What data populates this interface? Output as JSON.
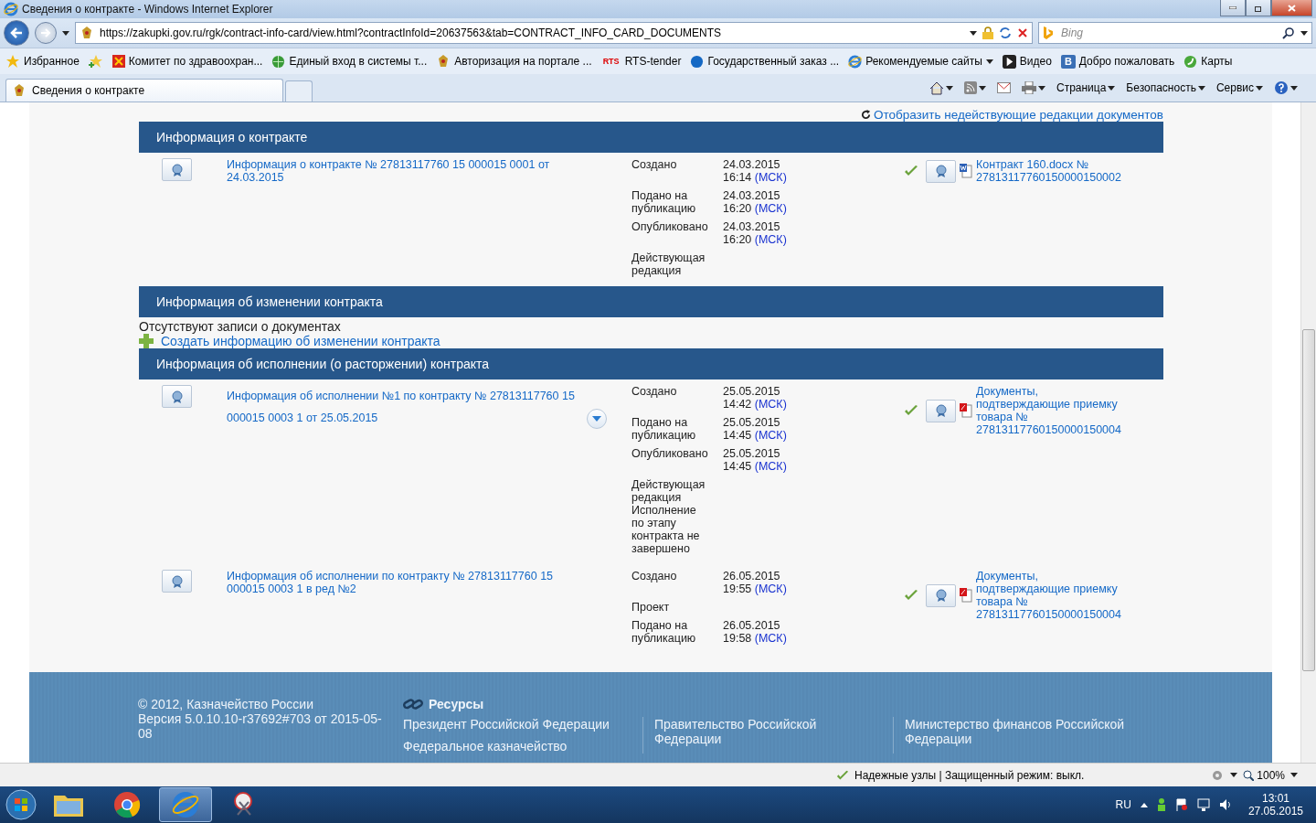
{
  "window": {
    "title": "Сведения о контракте - Windows Internet Explorer"
  },
  "address_bar": {
    "url": "https://zakupki.gov.ru/rgk/contract-info-card/view.html?contractInfoId=20637563&tab=CONTRACT_INFO_CARD_DOCUMENTS",
    "search_placeholder": "Bing"
  },
  "favorites_bar": {
    "title": "Избранное",
    "items": [
      {
        "label": "Комитет по здравоохран...",
        "kind": "red"
      },
      {
        "label": "Единый вход в системы т...",
        "kind": "green"
      },
      {
        "label": "Авторизация на портале ...",
        "kind": "emblem"
      },
      {
        "label": "RTS-tender",
        "kind": "logo",
        "badge": "RTS"
      },
      {
        "label": "Государственный заказ ...",
        "kind": "blue"
      },
      {
        "label": "Рекомендуемые сайты",
        "kind": "page",
        "dropdown": true
      },
      {
        "label": "Видео",
        "kind": "video"
      },
      {
        "label": "Добро пожаловать",
        "kind": "letter",
        "badge": "B"
      },
      {
        "label": "Карты",
        "kind": "maps"
      }
    ]
  },
  "tabs": [
    {
      "label": "Сведения о контракте",
      "selected": true
    }
  ],
  "command_bar": [
    "Страница",
    "Безопасность",
    "Сервис"
  ],
  "page": {
    "show_inactive_link": "Отобразить недействующие редакции документов",
    "sections": [
      {
        "title": "Информация о контракте",
        "records": [
          {
            "title": "Информация о контракте № 27813117760 15 000015 0001 от 24.03.2015",
            "expand_button": false,
            "events": [
              {
                "label": "Создано",
                "date": "24.03.2015",
                "time": "16:14",
                "tz": "(МСК)"
              },
              {
                "label": "Подано на публикацию",
                "date": "24.03.2015",
                "time": "16:20",
                "tz": "(МСК)"
              },
              {
                "label": "Опубликовано",
                "date": "24.03.2015",
                "time": "16:20",
                "tz": "(МСК)"
              },
              {
                "label": "Действующая редакция"
              }
            ],
            "document": {
              "name": "Контракт 160.docx № 27813117760150000150002",
              "kind": "word",
              "verified": true
            }
          }
        ]
      },
      {
        "title": "Информация об изменении контракта",
        "empty_text": "Отсутствуют записи о документах",
        "create_link": "Создать информацию об изменении контракта"
      },
      {
        "title": "Информация об исполнении (о расторжении) контракта",
        "records": [
          {
            "title": "Информация об исполнении №1 по контракту № 27813117760 15 000015 0003 1 от 25.05.2015",
            "expand_button": true,
            "events": [
              {
                "label": "Создано",
                "date": "25.05.2015",
                "time": "14:42",
                "tz": "(МСК)"
              },
              {
                "label": "Подано на публикацию",
                "date": "25.05.2015",
                "time": "14:45",
                "tz": "(МСК)"
              },
              {
                "label": "Опубликовано",
                "date": "25.05.2015",
                "time": "14:45",
                "tz": "(МСК)"
              },
              {
                "label": "Действующая редакция Исполнение по этапу контракта не завершено"
              }
            ],
            "document": {
              "name": "Документы, подтверждающие приемку товара № 27813117760150000150004",
              "kind": "pdf",
              "verified": true
            }
          },
          {
            "title": "Информация об исполнении по контракту № 27813117760 15 000015 0003 1 в ред №2",
            "expand_button": false,
            "events": [
              {
                "label": "Создано",
                "date": "26.05.2015",
                "time": "19:55",
                "tz": "(МСК)"
              },
              {
                "label": "Проект"
              },
              {
                "label": "Подано на публикацию",
                "date": "26.05.2015",
                "time": "19:58",
                "tz": "(МСК)"
              }
            ],
            "document": {
              "name": "Документы, подтверждающие приемку товара № 27813117760150000150004",
              "kind": "pdf",
              "verified": true
            }
          }
        ]
      }
    ]
  },
  "footer": {
    "copyright": "© 2012, Казначейство России",
    "version": "Версия 5.0.10.10-r37692#703 от 2015-05-08",
    "resources_title": "Ресурсы",
    "columns": [
      [
        "Президент Российской Федерации",
        "Федеральное казначейство"
      ],
      [
        "Правительство Российской Федерации"
      ],
      [
        "Министерство финансов Российской Федерации"
      ]
    ]
  },
  "status_bar": {
    "text": "Надежные узлы | Защищенный режим: выкл.",
    "zoom": "100%"
  },
  "taskbar": {
    "apps": [
      {
        "kind": "explorer",
        "selected": false
      },
      {
        "kind": "chrome",
        "selected": false
      },
      {
        "kind": "ie",
        "selected": true
      },
      {
        "kind": "snip",
        "selected": false
      }
    ],
    "language": "RU",
    "time": "13:01",
    "date": "27.05.2015"
  }
}
